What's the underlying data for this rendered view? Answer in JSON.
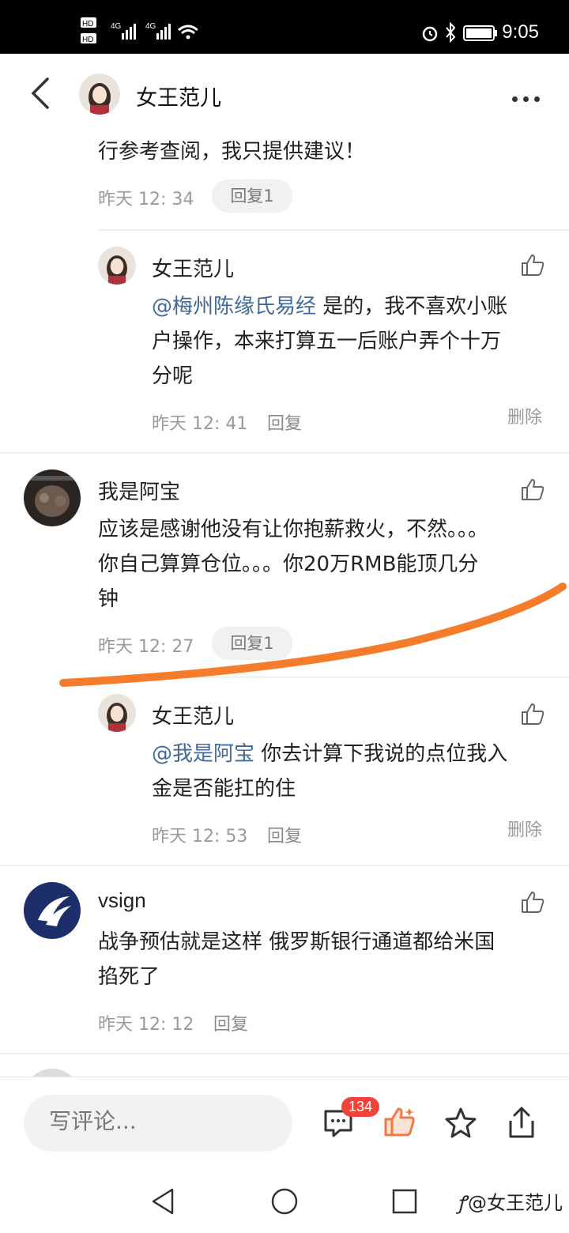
{
  "status_bar": {
    "time": "9:05",
    "network_1": "4G",
    "network_2": "4G"
  },
  "header": {
    "title": "女王范儿",
    "more": "more options"
  },
  "comments": [
    {
      "text_tail": "行参考查阅，我只提供建议！",
      "time": "昨天 12: 34",
      "reply_pill": "回复1"
    },
    {
      "author": "女王范儿",
      "mention": "@梅州陈缘氏易经",
      "text_line1_rest": " 是的，我不喜欢小账",
      "text_line2": "户操作，本来打算五一后账户弄个十万",
      "text_line3": "分呢",
      "time": "昨天 12: 41",
      "reply": "回复",
      "delete": "删除"
    },
    {
      "author": "我是阿宝",
      "text_line1": "应该是感谢他没有让你抱薪救火，不然。。。",
      "text_line2": "你自己算算仓位。。。你20万RMB能顶几分",
      "text_line3": "钟",
      "time": "昨天 12: 27",
      "reply_pill": "回复1"
    },
    {
      "author": "女王范儿",
      "mention": "@我是阿宝",
      "text_line1_rest": " 你去计算下我说的点位我入",
      "text_line2": "金是否能扛的住",
      "time": "昨天 12: 53",
      "reply": "回复",
      "delete": "删除"
    },
    {
      "author": "vsign",
      "text_line1": "战争预估就是这样 俄罗斯银行通道都给米国",
      "text_line2": "掐死了",
      "time": "昨天 12: 12",
      "reply": "回复"
    }
  ],
  "bottom_bar": {
    "placeholder": "写评论...",
    "comment_count": "134"
  },
  "watermark": "@女王范儿",
  "colors": {
    "mention": "#3f6a97",
    "badge": "#f0443b",
    "like_active": "#f07a46",
    "annotation": "#f57c2b"
  }
}
